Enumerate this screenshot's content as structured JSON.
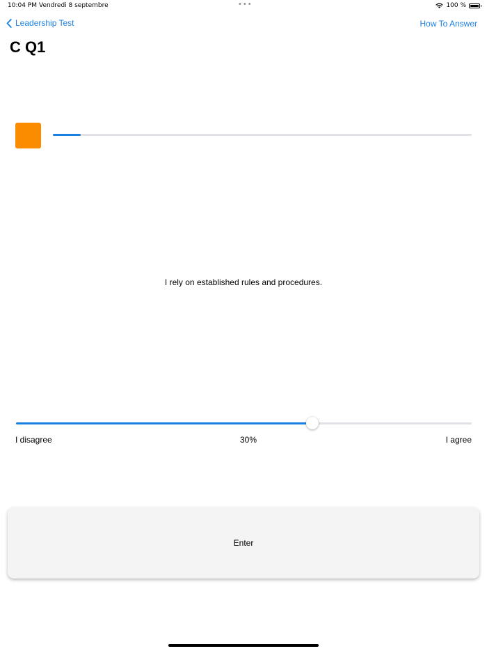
{
  "status_bar": {
    "time": "10:04 PM",
    "date": "Vendredi 8 septembre",
    "dots": "•••",
    "battery_percent": "100 %"
  },
  "nav": {
    "back_label": "Leadership Test",
    "right_label": "How To Answer"
  },
  "page": {
    "title": "C Q1"
  },
  "progress": {
    "indicator_color": "#fb8c00",
    "accent_color": "#1a7fe0",
    "fraction": 0.067
  },
  "question": {
    "text": "I rely on established rules and procedures."
  },
  "slider": {
    "min_label": "I disagree",
    "max_label": "I agree",
    "value": 65,
    "value_label": "30%"
  },
  "actions": {
    "enter_label": "Enter"
  }
}
